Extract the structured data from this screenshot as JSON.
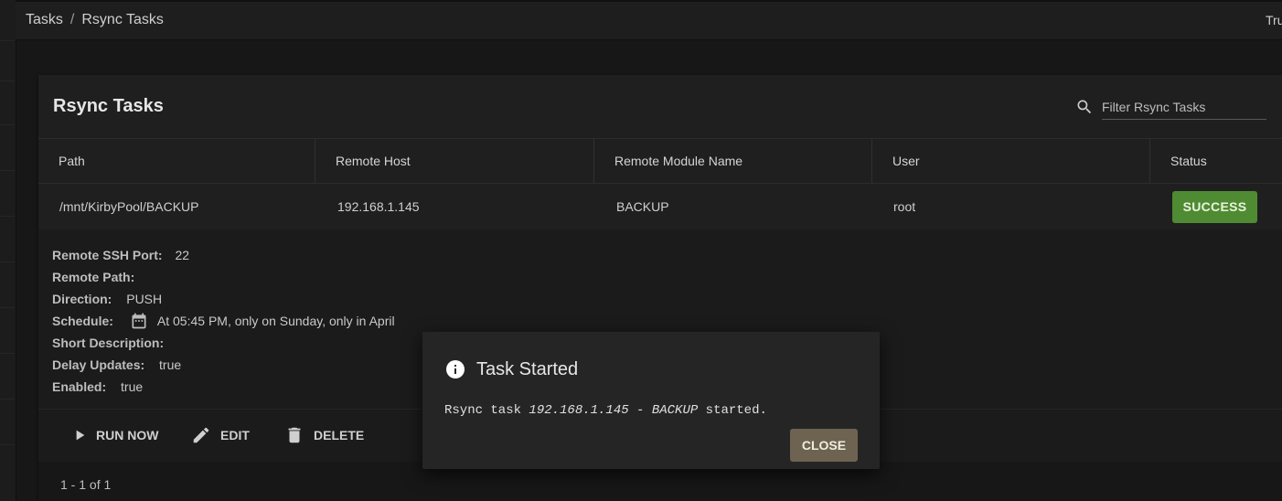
{
  "breadcrumb": {
    "items": [
      "Tasks",
      "Rsync Tasks"
    ],
    "separator": "/"
  },
  "header": {
    "right_text": "Tru"
  },
  "card": {
    "title": "Rsync Tasks",
    "search": {
      "placeholder": "Filter Rsync Tasks",
      "value": "",
      "icon": "search-icon"
    }
  },
  "table": {
    "columns": [
      "Path",
      "Remote Host",
      "Remote Module Name",
      "User",
      "Status"
    ],
    "rows": [
      {
        "path": "/mnt/KirbyPool/BACKUP",
        "remote_host": "192.168.1.145",
        "remote_module": "BACKUP",
        "user": "root",
        "status": "SUCCESS"
      }
    ]
  },
  "details": {
    "ssh_port_label": "Remote SSH Port:",
    "ssh_port_value": "22",
    "remote_path_label": "Remote Path:",
    "remote_path_value": "",
    "direction_label": "Direction:",
    "direction_value": "PUSH",
    "schedule_label": "Schedule:",
    "schedule_value": "At 05:45 PM, only on Sunday, only in April",
    "schedule_icon": "calendar-icon",
    "short_desc_label": "Short Description:",
    "short_desc_value": "",
    "delay_label": "Delay Updates:",
    "delay_value": "true",
    "enabled_label": "Enabled:",
    "enabled_value": "true"
  },
  "actions": {
    "run_now": "RUN NOW",
    "edit": "EDIT",
    "delete": "DELETE"
  },
  "pager": {
    "text": "1 - 1 of 1"
  },
  "dialog": {
    "title": "Task Started",
    "icon": "info-icon",
    "message_prefix": "Rsync task ",
    "message_task": "192.168.1.145 - BACKUP",
    "message_suffix": " started.",
    "close_label": "CLOSE"
  },
  "colors": {
    "success": "#4f8b32",
    "close_button": "#6e6350",
    "background": "#171717",
    "card": "#1f1f1f"
  }
}
